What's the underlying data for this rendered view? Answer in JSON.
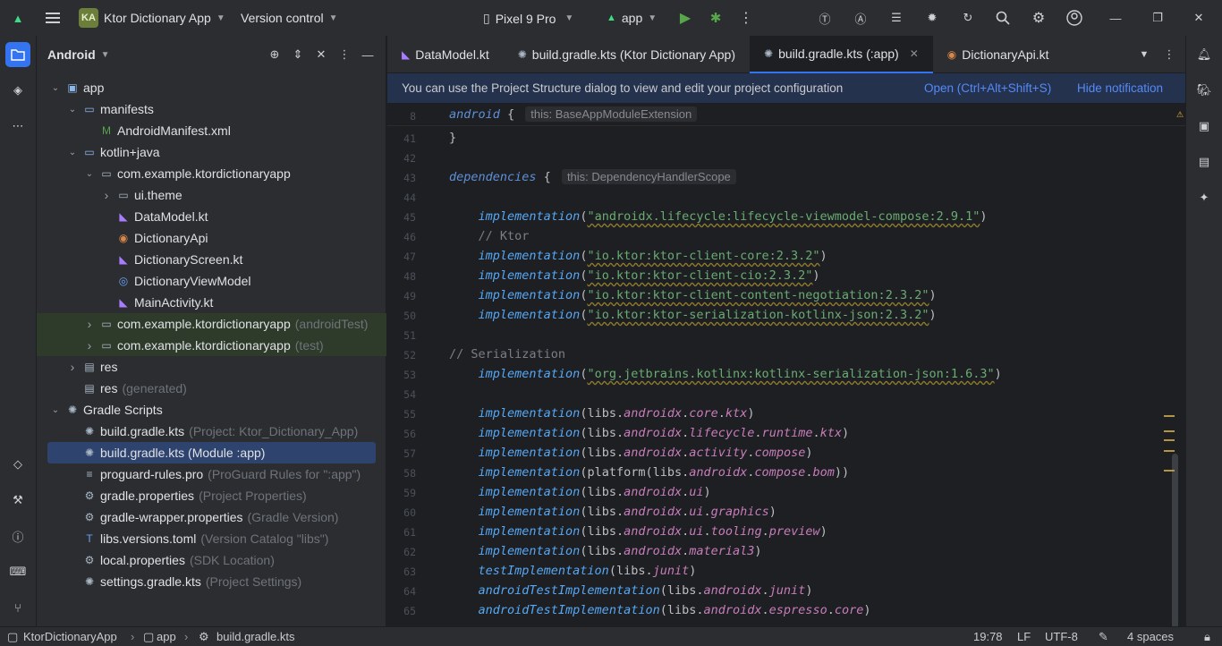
{
  "titlebar": {
    "project_initials": "KA",
    "project_name": "Ktor Dictionary App",
    "vcs": "Version control",
    "device": "Pixel 9 Pro",
    "run_config": "app"
  },
  "project_panel": {
    "view": "Android",
    "tree": [
      {
        "label": "app",
        "hint": "",
        "depth": 0,
        "arrow": "open",
        "icon": "module-icon"
      },
      {
        "label": "manifests",
        "hint": "",
        "depth": 1,
        "arrow": "open",
        "icon": "folder-icon"
      },
      {
        "label": "AndroidManifest.xml",
        "hint": "",
        "depth": 2,
        "arrow": "",
        "icon": "manifest-icon"
      },
      {
        "label": "kotlin+java",
        "hint": "",
        "depth": 1,
        "arrow": "open",
        "icon": "folder-icon"
      },
      {
        "label": "com.example.ktordictionaryapp",
        "hint": "",
        "depth": 2,
        "arrow": "open",
        "icon": "package-icon"
      },
      {
        "label": "ui.theme",
        "hint": "",
        "depth": 3,
        "arrow": "closed",
        "icon": "package-icon"
      },
      {
        "label": "DataModel.kt",
        "hint": "",
        "depth": 3,
        "arrow": "",
        "icon": "kotlin-file-icon"
      },
      {
        "label": "DictionaryApi",
        "hint": "",
        "depth": 3,
        "arrow": "",
        "icon": "interface-icon"
      },
      {
        "label": "DictionaryScreen.kt",
        "hint": "",
        "depth": 3,
        "arrow": "",
        "icon": "kotlin-file-icon"
      },
      {
        "label": "DictionaryViewModel",
        "hint": "",
        "depth": 3,
        "arrow": "",
        "icon": "class-icon"
      },
      {
        "label": "MainActivity.kt",
        "hint": "",
        "depth": 3,
        "arrow": "",
        "icon": "kotlin-file-icon"
      },
      {
        "label": "com.example.ktordictionaryapp",
        "hint": "(androidTest)",
        "depth": 2,
        "arrow": "closed",
        "icon": "package-icon"
      },
      {
        "label": "com.example.ktordictionaryapp",
        "hint": "(test)",
        "depth": 2,
        "arrow": "closed",
        "icon": "package-icon"
      },
      {
        "label": "res",
        "hint": "",
        "depth": 1,
        "arrow": "closed",
        "icon": "res-folder-icon"
      },
      {
        "label": "res",
        "hint": "(generated)",
        "depth": 1,
        "arrow": "",
        "icon": "res-folder-icon"
      },
      {
        "label": "Gradle Scripts",
        "hint": "",
        "depth": 0,
        "arrow": "open",
        "icon": "gradle-icon"
      },
      {
        "label": "build.gradle.kts",
        "hint": "(Project: Ktor_Dictionary_App)",
        "depth": 1,
        "arrow": "",
        "icon": "gradle-file-icon"
      },
      {
        "label": "build.gradle.kts (Module :app)",
        "hint": "",
        "depth": 1,
        "arrow": "",
        "icon": "gradle-file-icon"
      },
      {
        "label": "proguard-rules.pro",
        "hint": "(ProGuard Rules for \":app\")",
        "depth": 1,
        "arrow": "",
        "icon": "text-file-icon"
      },
      {
        "label": "gradle.properties",
        "hint": "(Project Properties)",
        "depth": 1,
        "arrow": "",
        "icon": "settings-file-icon"
      },
      {
        "label": "gradle-wrapper.properties",
        "hint": "(Gradle Version)",
        "depth": 1,
        "arrow": "",
        "icon": "settings-file-icon"
      },
      {
        "label": "libs.versions.toml",
        "hint": "(Version Catalog \"libs\")",
        "depth": 1,
        "arrow": "",
        "icon": "toml-file-icon"
      },
      {
        "label": "local.properties",
        "hint": "(SDK Location)",
        "depth": 1,
        "arrow": "",
        "icon": "settings-file-icon"
      },
      {
        "label": "settings.gradle.kts",
        "hint": "(Project Settings)",
        "depth": 1,
        "arrow": "",
        "icon": "gradle-file-icon"
      }
    ]
  },
  "tabs": [
    {
      "label": "DataModel.kt",
      "icon": "kotlin-file-icon"
    },
    {
      "label": "build.gradle.kts (Ktor Dictionary App)",
      "icon": "gradle-file-icon"
    },
    {
      "label": "build.gradle.kts (:app)",
      "icon": "gradle-file-icon"
    },
    {
      "label": "DictionaryApi.kt",
      "icon": "interface-icon"
    }
  ],
  "notification": {
    "message": "You can use the Project Structure dialog to view and edit your project configuration",
    "open_link": "Open (Ctrl+Alt+Shift+S)",
    "hide_link": "Hide notification"
  },
  "code": {
    "sticky_line": "8",
    "sticky_text": "android",
    "sticky_hint": "this: BaseAppModuleExtension",
    "lines": [
      {
        "n": "41",
        "text": "}"
      },
      {
        "n": "42",
        "text": ""
      },
      {
        "n": "43",
        "text": "dependencies {",
        "hint": "this: DependencyHandlerScope"
      },
      {
        "n": "44",
        "text": ""
      },
      {
        "n": "45",
        "text": "    implementation(\"androidx.lifecycle:lifecycle-viewmodel-compose:2.9.1\")"
      },
      {
        "n": "46",
        "text": "    // Ktor"
      },
      {
        "n": "47",
        "text": "    implementation(\"io.ktor:ktor-client-core:2.3.2\")"
      },
      {
        "n": "48",
        "text": "    implementation(\"io.ktor:ktor-client-cio:2.3.2\")"
      },
      {
        "n": "49",
        "text": "    implementation(\"io.ktor:ktor-client-content-negotiation:2.3.2\")"
      },
      {
        "n": "50",
        "text": "    implementation(\"io.ktor:ktor-serialization-kotlinx-json:2.3.2\")"
      },
      {
        "n": "51",
        "text": ""
      },
      {
        "n": "52",
        "text": "// Serialization"
      },
      {
        "n": "53",
        "text": "    implementation(\"org.jetbrains.kotlinx:kotlinx-serialization-json:1.6.3\")"
      },
      {
        "n": "54",
        "text": ""
      },
      {
        "n": "55",
        "text": "    implementation(libs.androidx.core.ktx)"
      },
      {
        "n": "56",
        "text": "    implementation(libs.androidx.lifecycle.runtime.ktx)"
      },
      {
        "n": "57",
        "text": "    implementation(libs.androidx.activity.compose)"
      },
      {
        "n": "58",
        "text": "    implementation(platform(libs.androidx.compose.bom))"
      },
      {
        "n": "59",
        "text": "    implementation(libs.androidx.ui)"
      },
      {
        "n": "60",
        "text": "    implementation(libs.androidx.ui.graphics)"
      },
      {
        "n": "61",
        "text": "    implementation(libs.androidx.ui.tooling.preview)"
      },
      {
        "n": "62",
        "text": "    implementation(libs.androidx.material3)"
      },
      {
        "n": "63",
        "text": "    testImplementation(libs.junit)"
      },
      {
        "n": "64",
        "text": "    androidTestImplementation(libs.androidx.junit)"
      },
      {
        "n": "65",
        "text": "    androidTestImplementation(libs.androidx.espresso.core)"
      }
    ]
  },
  "statusbar": {
    "breadcrumb": [
      "KtorDictionaryApp",
      "app",
      "build.gradle.kts"
    ],
    "position": "19:78",
    "line_sep": "LF",
    "encoding": "UTF-8",
    "indent": "4 spaces"
  }
}
